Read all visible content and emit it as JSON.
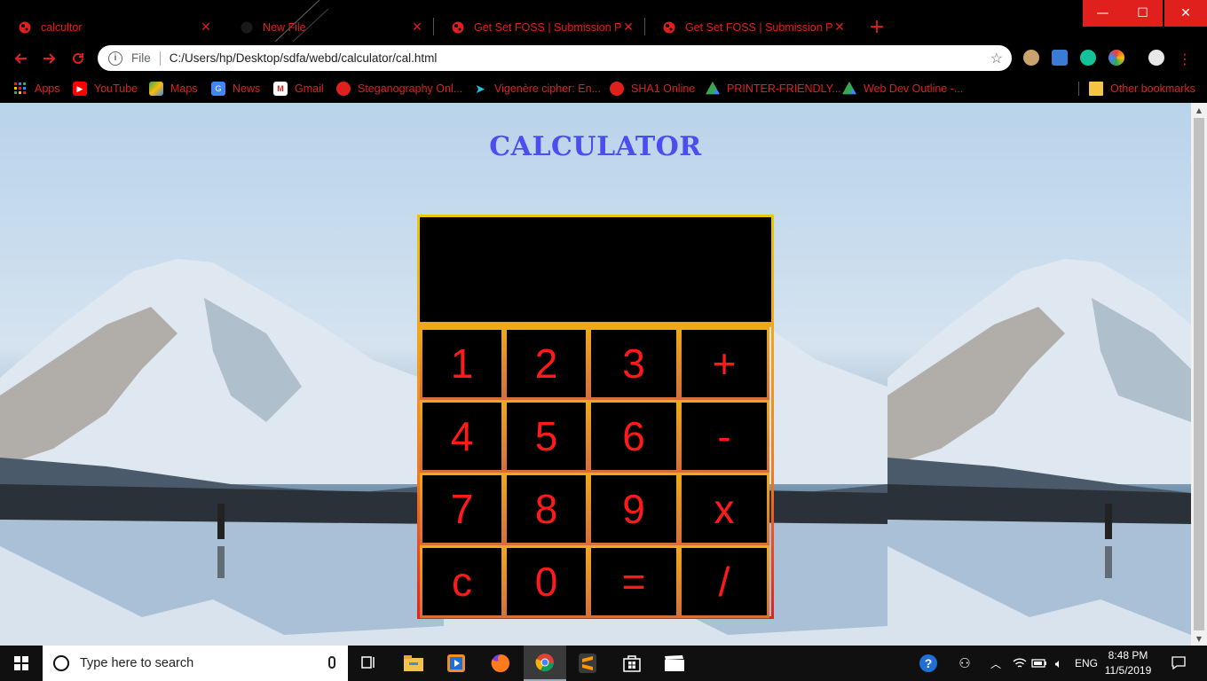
{
  "browser": {
    "tabs": [
      {
        "title": "calcultor",
        "active": true
      },
      {
        "title": "New File",
        "active": false
      },
      {
        "title": "Get Set FOSS | Submission Portal",
        "active": false
      },
      {
        "title": "Get Set FOSS | Submission Portal",
        "active": false
      }
    ],
    "address": {
      "scheme_label": "File",
      "url": "C:/Users/hp/Desktop/sdfa/webd/calculator/cal.html"
    },
    "bookmarks": [
      {
        "label": "Apps",
        "icon": "apps-grid-icon"
      },
      {
        "label": "YouTube",
        "icon": "youtube-icon"
      },
      {
        "label": "Maps",
        "icon": "maps-icon"
      },
      {
        "label": "News",
        "icon": "news-icon"
      },
      {
        "label": "Gmail",
        "icon": "gmail-icon"
      },
      {
        "label": "Steganography Onl...",
        "icon": "globe-icon"
      },
      {
        "label": "Vigenère cipher: En...",
        "icon": "arrow-icon"
      },
      {
        "label": "SHA1 Online",
        "icon": "globe-icon"
      },
      {
        "label": "PRINTER-FRIENDLY...",
        "icon": "drive-icon"
      },
      {
        "label": "Web Dev Outline -...",
        "icon": "drive-icon"
      }
    ],
    "other_bookmarks": "Other bookmarks",
    "accent_color": "#e0201c"
  },
  "calculator": {
    "title": "CALCULATOR",
    "display_value": "",
    "keys": [
      "1",
      "2",
      "3",
      "+",
      "4",
      "5",
      "6",
      "-",
      "7",
      "8",
      "9",
      "x",
      "c",
      "0",
      "=",
      "/"
    ],
    "title_color": "#4a4ef0",
    "key_text_color": "#ff1a1a"
  },
  "taskbar": {
    "search_placeholder": "Type here to search",
    "language": "ENG",
    "time": "8:48 PM",
    "date": "11/5/2019"
  }
}
